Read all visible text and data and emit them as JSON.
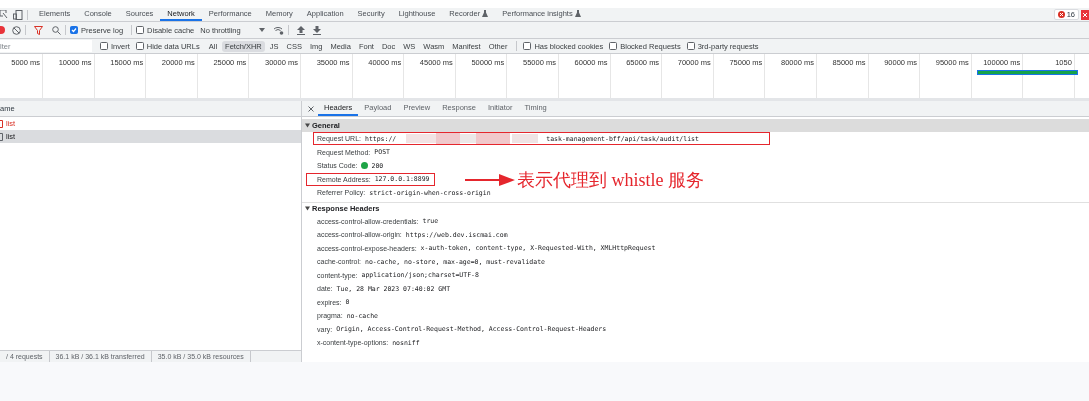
{
  "devtools_tabs": [
    {
      "label": "Elements",
      "selected": false,
      "experimental": false
    },
    {
      "label": "Console",
      "selected": false,
      "experimental": false
    },
    {
      "label": "Sources",
      "selected": false,
      "experimental": false
    },
    {
      "label": "Network",
      "selected": true,
      "experimental": false
    },
    {
      "label": "Performance",
      "selected": false,
      "experimental": false
    },
    {
      "label": "Memory",
      "selected": false,
      "experimental": false
    },
    {
      "label": "Application",
      "selected": false,
      "experimental": false
    },
    {
      "label": "Security",
      "selected": false,
      "experimental": false
    },
    {
      "label": "Lighthouse",
      "selected": false,
      "experimental": false
    },
    {
      "label": "Recorder",
      "selected": false,
      "experimental": true
    },
    {
      "label": "Performance insights",
      "selected": false,
      "experimental": true
    }
  ],
  "error_count": "16",
  "toolbar": {
    "preserve_log": {
      "label": "Preserve log",
      "checked": true
    },
    "disable_cache": {
      "label": "Disable cache",
      "checked": false
    },
    "throttling": "No throttling"
  },
  "filter_bar": {
    "placeholder": "lter",
    "checkboxes_left": [
      {
        "label": "Invert",
        "checked": false
      },
      {
        "label": "Hide data URLs",
        "checked": false
      }
    ],
    "types": [
      {
        "label": "All",
        "selected": false
      },
      {
        "label": "Fetch/XHR",
        "selected": true
      },
      {
        "label": "JS",
        "selected": false
      },
      {
        "label": "CSS",
        "selected": false
      },
      {
        "label": "Img",
        "selected": false
      },
      {
        "label": "Media",
        "selected": false
      },
      {
        "label": "Font",
        "selected": false
      },
      {
        "label": "Doc",
        "selected": false
      },
      {
        "label": "WS",
        "selected": false
      },
      {
        "label": "Wasm",
        "selected": false
      },
      {
        "label": "Manifest",
        "selected": false
      },
      {
        "label": "Other",
        "selected": false
      }
    ],
    "checkboxes_right": [
      {
        "label": "Has blocked cookies",
        "checked": false
      },
      {
        "label": "Blocked Requests",
        "checked": false
      },
      {
        "label": "3rd-party requests",
        "checked": false
      }
    ]
  },
  "timeline": {
    "ticks": [
      "5000 ms",
      "10000 ms",
      "15000 ms",
      "20000 ms",
      "25000 ms",
      "30000 ms",
      "35000 ms",
      "40000 ms",
      "45000 ms",
      "50000 ms",
      "55000 ms",
      "60000 ms",
      "65000 ms",
      "70000 ms",
      "75000 ms",
      "80000 ms",
      "85000 ms",
      "90000 ms",
      "95000 ms",
      "100000 ms",
      "1050"
    ]
  },
  "requests": {
    "column": "ame",
    "rows": [
      {
        "name": "list",
        "failed": true,
        "selected": false
      },
      {
        "name": "list",
        "failed": false,
        "selected": true
      }
    ]
  },
  "status_bar": [
    "/ 4 requests",
    "36.1 kB / 36.1 kB transferred",
    "35.0 kB / 35.0 kB resources"
  ],
  "detail_tabs": [
    {
      "label": "Headers",
      "selected": true
    },
    {
      "label": "Payload",
      "selected": false
    },
    {
      "label": "Preview",
      "selected": false
    },
    {
      "label": "Response",
      "selected": false
    },
    {
      "label": "Initiator",
      "selected": false
    },
    {
      "label": "Timing",
      "selected": false
    }
  ],
  "sections": [
    {
      "title": "General",
      "expanded": true,
      "highlighted": true,
      "rows": [
        {
          "kind": "redacted",
          "name": "Request URL:",
          "value_start": "https://",
          "value_end": "task-management-bff/api/task/audit/list",
          "boxed": true
        },
        {
          "kind": "plain",
          "name": "Request Method:",
          "value": "POST",
          "boxed": false
        },
        {
          "kind": "status",
          "name": "Status Code:",
          "value": "200",
          "color": "#1ea446",
          "boxed": false
        },
        {
          "kind": "plain",
          "name": "Remote Address:",
          "value": "127.0.0.1:8899",
          "boxed": true,
          "callout": "表示代理到 whistle 服务"
        },
        {
          "kind": "plain",
          "name": "Referrer Policy:",
          "value": "strict-origin-when-cross-origin",
          "boxed": false
        }
      ]
    },
    {
      "title": "Response Headers",
      "expanded": true,
      "highlighted": false,
      "rows": [
        {
          "kind": "plain",
          "name": "access-control-allow-credentials:",
          "value": "true",
          "boxed": false
        },
        {
          "kind": "plain",
          "name": "access-control-allow-origin:",
          "value": "https://web.dev.iscmai.com",
          "boxed": false
        },
        {
          "kind": "plain",
          "name": "access-control-expose-headers:",
          "value": "x-auth-token, content-type, X-Requested-With, XMLHttpRequest",
          "boxed": false
        },
        {
          "kind": "plain",
          "name": "cache-control:",
          "value": "no-cache, no-store, max-age=0, must-revalidate",
          "boxed": false
        },
        {
          "kind": "plain",
          "name": "content-type:",
          "value": "application/json;charset=UTF-8",
          "boxed": false
        },
        {
          "kind": "plain",
          "name": "date:",
          "value": "Tue, 28 Mar 2023 07:40:02 GMT",
          "boxed": false
        },
        {
          "kind": "plain",
          "name": "expires:",
          "value": "0",
          "boxed": false
        },
        {
          "kind": "plain",
          "name": "pragma:",
          "value": "no-cache",
          "boxed": false
        },
        {
          "kind": "plain",
          "name": "vary:",
          "value": "Origin, Access-Control-Request-Method, Access-Control-Request-Headers",
          "boxed": false
        },
        {
          "kind": "plain",
          "name": "x-content-type-options:",
          "value": "nosniff",
          "boxed": false
        }
      ]
    }
  ]
}
